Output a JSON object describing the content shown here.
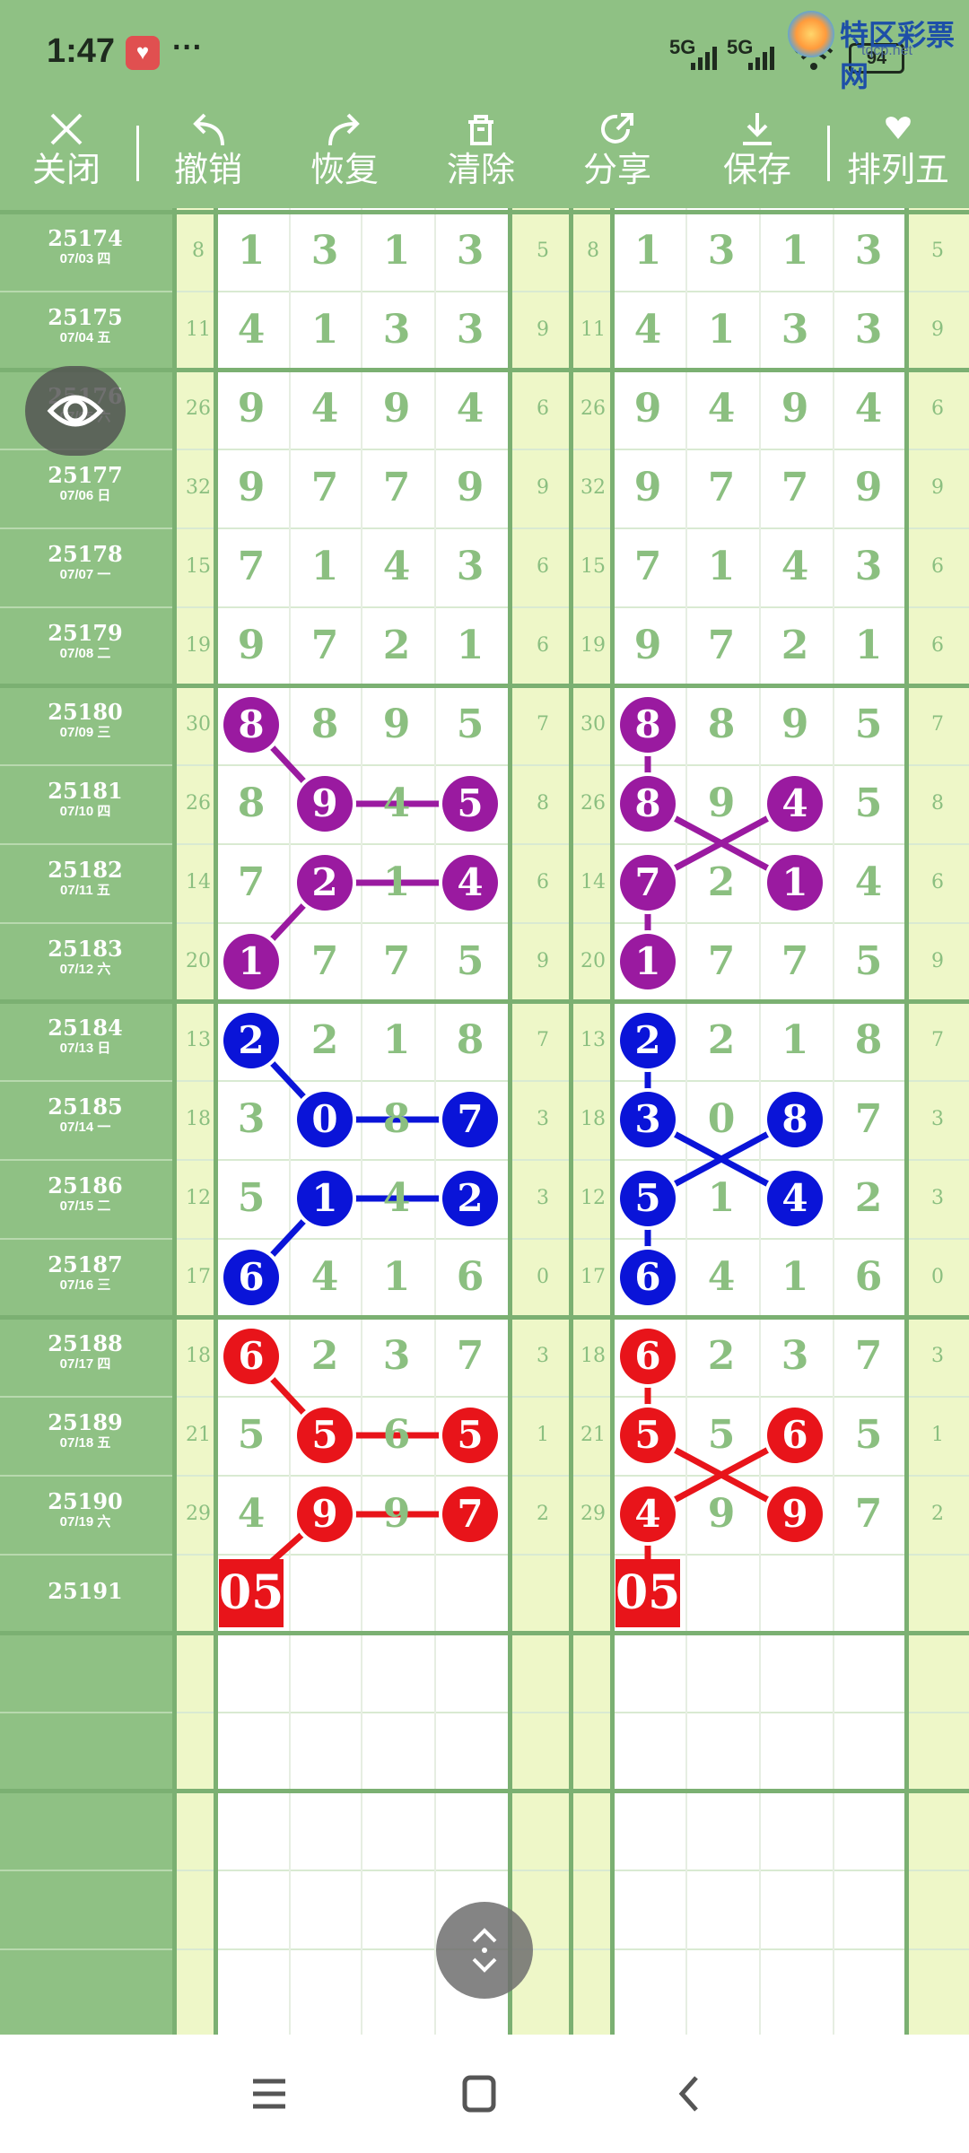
{
  "status_bar": {
    "time": "1:47",
    "more": "···",
    "signal_1": "5G",
    "signal_2": "5G",
    "battery": "94",
    "watermark_title": "特区彩票网",
    "watermark_url": "tqcp.net"
  },
  "toolbar": {
    "items": [
      {
        "label": "关闭",
        "icon": "close-icon"
      },
      {
        "label": "撤销",
        "icon": "undo-icon"
      },
      {
        "label": "恢复",
        "icon": "redo-icon"
      },
      {
        "label": "清除",
        "icon": "trash-icon"
      },
      {
        "label": "分享",
        "icon": "share-icon"
      },
      {
        "label": "保存",
        "icon": "download-icon"
      },
      {
        "label": "排列五",
        "icon": "dropdown-heart-icon"
      }
    ]
  },
  "table": {
    "rows": [
      {
        "issue": "25174",
        "date": "07/03 四",
        "sum": "8",
        "digits": [
          "1",
          "3",
          "1",
          "3"
        ],
        "last": "5"
      },
      {
        "issue": "25175",
        "date": "07/04 五",
        "sum": "11",
        "digits": [
          "4",
          "1",
          "3",
          "3"
        ],
        "last": "9"
      },
      {
        "issue": "25176",
        "date": "07/05 六",
        "sum": "26",
        "digits": [
          "9",
          "4",
          "9",
          "4"
        ],
        "last": "6"
      },
      {
        "issue": "25177",
        "date": "07/06 日",
        "sum": "32",
        "digits": [
          "9",
          "7",
          "7",
          "9"
        ],
        "last": "9"
      },
      {
        "issue": "25178",
        "date": "07/07 一",
        "sum": "15",
        "digits": [
          "7",
          "1",
          "4",
          "3"
        ],
        "last": "6"
      },
      {
        "issue": "25179",
        "date": "07/08 二",
        "sum": "19",
        "digits": [
          "9",
          "7",
          "2",
          "1"
        ],
        "last": "6"
      },
      {
        "issue": "25180",
        "date": "07/09 三",
        "sum": "30",
        "digits": [
          "8",
          "8",
          "9",
          "5"
        ],
        "last": "7"
      },
      {
        "issue": "25181",
        "date": "07/10 四",
        "sum": "26",
        "digits": [
          "8",
          "9",
          "4",
          "5"
        ],
        "last": "8"
      },
      {
        "issue": "25182",
        "date": "07/11 五",
        "sum": "14",
        "digits": [
          "7",
          "2",
          "1",
          "4"
        ],
        "last": "6"
      },
      {
        "issue": "25183",
        "date": "07/12 六",
        "sum": "20",
        "digits": [
          "1",
          "7",
          "7",
          "5"
        ],
        "last": "9"
      },
      {
        "issue": "25184",
        "date": "07/13 日",
        "sum": "13",
        "digits": [
          "2",
          "2",
          "1",
          "8"
        ],
        "last": "7"
      },
      {
        "issue": "25185",
        "date": "07/14 一",
        "sum": "18",
        "digits": [
          "3",
          "0",
          "8",
          "7"
        ],
        "last": "3"
      },
      {
        "issue": "25186",
        "date": "07/15 二",
        "sum": "12",
        "digits": [
          "5",
          "1",
          "4",
          "2"
        ],
        "last": "3"
      },
      {
        "issue": "25187",
        "date": "07/16 三",
        "sum": "17",
        "digits": [
          "6",
          "4",
          "1",
          "6"
        ],
        "last": "0"
      },
      {
        "issue": "25188",
        "date": "07/17 四",
        "sum": "18",
        "digits": [
          "6",
          "2",
          "3",
          "7"
        ],
        "last": "3"
      },
      {
        "issue": "25189",
        "date": "07/18 五",
        "sum": "21",
        "digits": [
          "5",
          "5",
          "6",
          "5"
        ],
        "last": "1"
      },
      {
        "issue": "25190",
        "date": "07/19 六",
        "sum": "29",
        "digits": [
          "4",
          "9",
          "9",
          "7"
        ],
        "last": "2"
      },
      {
        "issue": "25191",
        "date": "",
        "sum": "",
        "digits": [
          "",
          "",
          "",
          ""
        ],
        "last": ""
      }
    ],
    "prediction_left": "05",
    "prediction_right": "05",
    "colors": {
      "purple": "#9a1aa0",
      "blue": "#0a14d8",
      "red": "#e8141a",
      "grid_green": "#7bb072",
      "digit_green": "#8bbf80",
      "side_yellow": "#eef7c8",
      "issue_green": "#8fc184"
    }
  },
  "buttons": {
    "eye": "eye-icon",
    "scroll": "scroll-updown-icon"
  },
  "navbar": {
    "menu": "menu-icon",
    "home": "home-square-icon",
    "back": "back-chevron-icon"
  }
}
